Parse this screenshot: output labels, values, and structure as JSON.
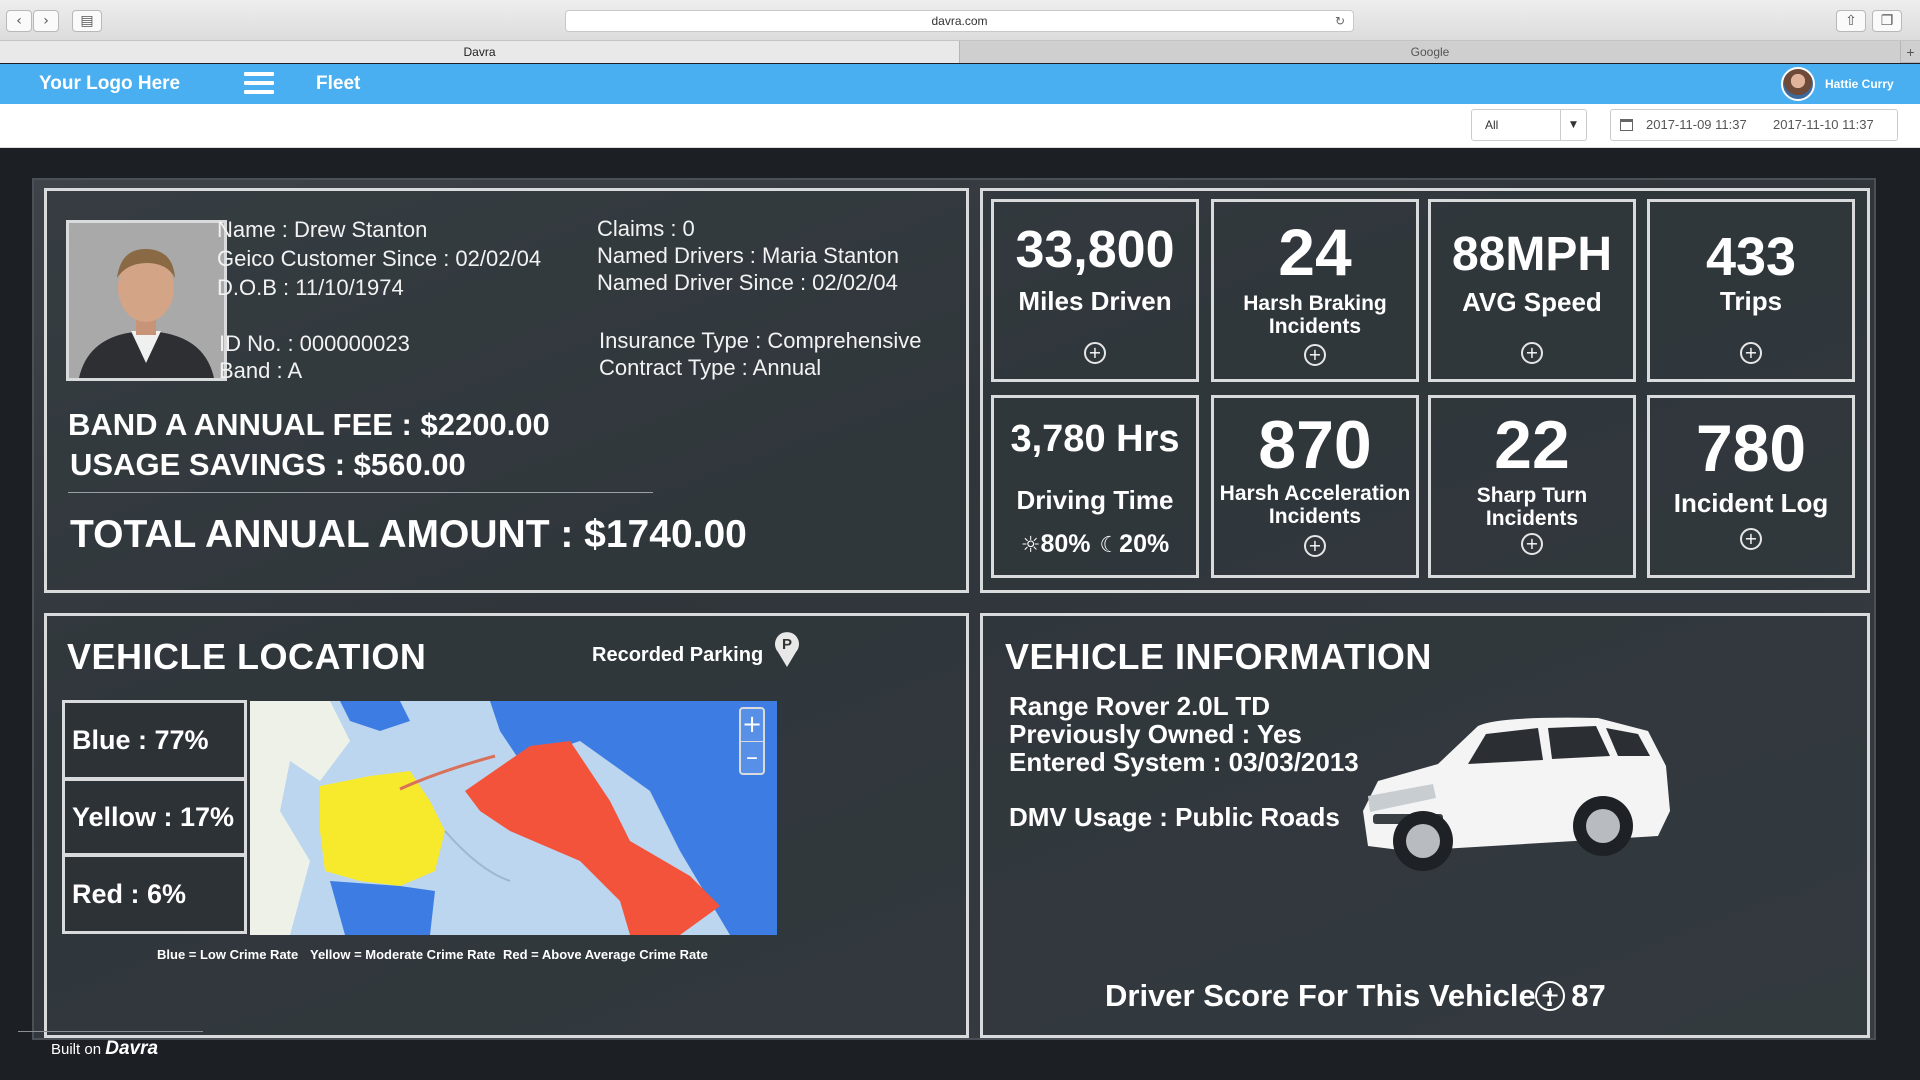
{
  "browser": {
    "back_icon": "chevron-left-icon",
    "forward_icon": "chevron-right-icon",
    "url": "davra.com",
    "tabs": [
      "Davra",
      "Google"
    ]
  },
  "header": {
    "logo": "Your Logo Here",
    "nav_label": "Fleet",
    "user_name": "Hattie Curry",
    "brand_color": "#4aaff0"
  },
  "filters": {
    "select_value": "All",
    "date_start": "2017-11-09  11:37",
    "date_end": "2017-11-10  11:37"
  },
  "profile": {
    "name": "Name : Drew Stanton",
    "customer_since": "Geico Customer Since : 02/02/04",
    "dob": "D.O.B : 11/10/1974",
    "id_no": "ID No. : 000000023",
    "band": "Band : A",
    "claims": "Claims : 0",
    "named_drivers": "Named Drivers : Maria Stanton",
    "named_driver_since": "Named Driver Since : 02/02/04",
    "insurance_type": "Insurance Type : Comprehensive",
    "contract_type": "Contract Type : Annual",
    "annual_fee": "BAND A ANNUAL FEE : $2200.00",
    "usage_savings": "USAGE SAVINGS : $560.00",
    "total": "TOTAL ANNUAL AMOUNT : $1740.00"
  },
  "stats": [
    {
      "value": "33,800",
      "label": "Miles Driven"
    },
    {
      "value": "24",
      "label": "Harsh Braking Incidents"
    },
    {
      "value": "88MPH",
      "label": "AVG Speed"
    },
    {
      "value": "433",
      "label": "Trips"
    },
    {
      "value": "3,780 Hrs",
      "label": "Driving Time",
      "day_pct": "80%",
      "night_pct": "20%"
    },
    {
      "value": "870",
      "label": "Harsh Acceleration Incidents"
    },
    {
      "value": "22",
      "label": "Sharp Turn Incidents"
    },
    {
      "value": "780",
      "label": "Incident Log"
    }
  ],
  "location": {
    "title": "VEHICLE LOCATION",
    "parking_label": "Recorded Parking",
    "zones": [
      "Blue : 77%",
      "Yellow : 17%",
      "Red : 6%"
    ],
    "legend": [
      "Blue = Low Crime Rate",
      "Yellow = Moderate Crime Rate",
      "Red = Above Average Crime Rate"
    ],
    "zone_colors": {
      "blue": "#3d7de3",
      "yellow": "#f7ea2c",
      "red": "#f2533a"
    }
  },
  "vehicle": {
    "title": "VEHICLE INFORMATION",
    "model": "Range Rover 2.0L TD",
    "previously_owned": "Previously Owned : Yes",
    "entered_system": "Entered System : 03/03/2013",
    "dmv_usage": "DMV Usage : Public Roads",
    "score_label": "Driver Score For This Vehicle :",
    "score_value": "87"
  },
  "footer": {
    "built_on": "Built on",
    "brand": "Davra"
  }
}
